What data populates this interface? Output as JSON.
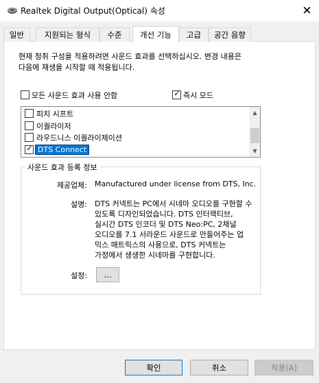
{
  "window": {
    "title": "Realtek Digital Output(Optical) 속성",
    "icon": "speaker-icon",
    "close_glyph": "✕"
  },
  "tabs": [
    {
      "label": "일반",
      "active": false
    },
    {
      "label": "지원되는 형식",
      "active": false
    },
    {
      "label": "수준",
      "active": false
    },
    {
      "label": "개선 기능",
      "active": true
    },
    {
      "label": "고급",
      "active": false
    },
    {
      "label": "공간 음향",
      "active": false
    }
  ],
  "enhancements": {
    "description_line1": "현재 청취 구성을 적용하려면 사운드 효과를 선택하십시오. 변경 내용은",
    "description_line2": "다음에 재생을 시작할 때 적용됩니다.",
    "disable_all_label": "모든 사운드 효과 사용 안함",
    "disable_all_checked": false,
    "immediate_mode_label": "즉시 모드",
    "immediate_mode_checked": true,
    "items": [
      {
        "label": "피치 시프트",
        "checked": false,
        "selected": false
      },
      {
        "label": "이퀄라이저",
        "checked": false,
        "selected": false
      },
      {
        "label": "라우드니스 이퀄라이제이션",
        "checked": false,
        "selected": false
      },
      {
        "label": "DTS Connect",
        "checked": true,
        "selected": true
      }
    ]
  },
  "info": {
    "group_title": "사운드 효과 등록 정보",
    "provider_label": "제공업체:",
    "provider_value": "Manufactured under license from DTS, Inc.",
    "description_label": "설명:",
    "description_value": "DTS 커넥트는 PC에서 시네마 오디오를 구현할 수 있도록 디자인되었습니다. DTS 인터랙티브, 실시간 DTS 인코더 및 DTS Neo:PC, 2채널 오디오를 7.1 서라운드 사운드로 만들어주는 업 믹스 매트릭스의 사용으로, DTS 커넥트는 가정에서 생생한 시네마를 구현합니다.",
    "settings_label": "설정:",
    "settings_button": "..."
  },
  "buttons": {
    "ok": "확인",
    "cancel": "취소",
    "apply": "적용(A)"
  }
}
